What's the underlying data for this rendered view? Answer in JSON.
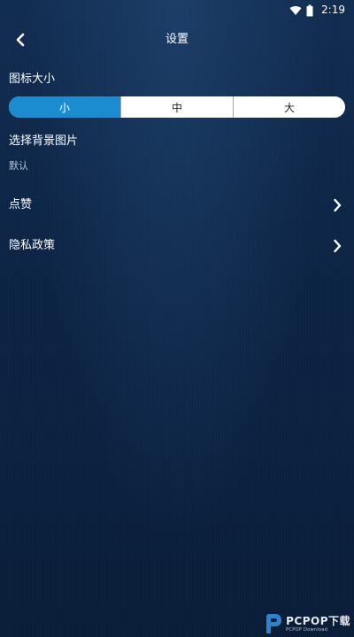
{
  "status_bar": {
    "time": "2:19",
    "icons": [
      "wifi-icon",
      "battery-icon"
    ]
  },
  "toolbar": {
    "title": "设置",
    "back_icon": "chevron-left-icon"
  },
  "icon_size": {
    "label": "图标大小",
    "options": [
      "小",
      "中",
      "大"
    ],
    "selected": "小"
  },
  "background": {
    "label": "选择背景图片",
    "value": "默认"
  },
  "rows": [
    {
      "label": "点赞",
      "icon": "chevron-right-icon"
    },
    {
      "label": "隐私政策",
      "icon": "chevron-right-icon"
    }
  ],
  "watermark": {
    "text": "PCPOP下载",
    "subtext": "PCPOP Download"
  },
  "colors": {
    "background": "#0d2444",
    "accent": "#1a8ccf",
    "text": "#ffffff",
    "secondary_text": "#b7c3d2"
  }
}
